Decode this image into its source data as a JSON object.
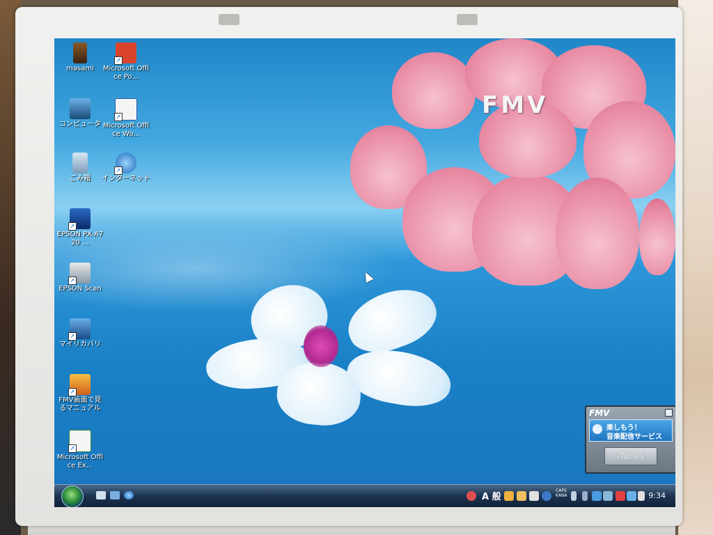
{
  "desktop": {
    "icons": [
      {
        "label": "masami",
        "icon": "user-folder-icon"
      },
      {
        "label": "Microsoft Office Po...",
        "icon": "powerpoint-icon"
      },
      {
        "label": "コンピュータ",
        "icon": "computer-icon"
      },
      {
        "label": "Microsoft Office Wo...",
        "icon": "word-icon"
      },
      {
        "label": "ごみ箱",
        "icon": "recycle-bin-icon"
      },
      {
        "label": "インターネット",
        "icon": "internet-explorer-icon"
      },
      {
        "label": "EPSON PX-A720 ...",
        "icon": "epson-printer-icon"
      },
      {
        "label": "EPSON Scan",
        "icon": "epson-scan-icon"
      },
      {
        "label": "マイリカバリ",
        "icon": "my-recovery-icon"
      },
      {
        "label": "FMV画面で見るマニュアル",
        "icon": "fmv-manual-icon"
      },
      {
        "label": "Microsoft Office Ex...",
        "icon": "excel-icon"
      }
    ],
    "wallpaper_logo": "FMV"
  },
  "fmv_widget": {
    "logo": "FMV",
    "line1": "楽しもう！",
    "line2": "音楽配信サービス",
    "button": "iTunes"
  },
  "taskbar": {
    "ime": "A 般",
    "caps": "CAPS",
    "kana": "KANA",
    "clock": "9:34"
  },
  "colors": {
    "sky": "#2c96d8",
    "blossom": "#e88aa3",
    "taskbar": "#1c3350"
  }
}
